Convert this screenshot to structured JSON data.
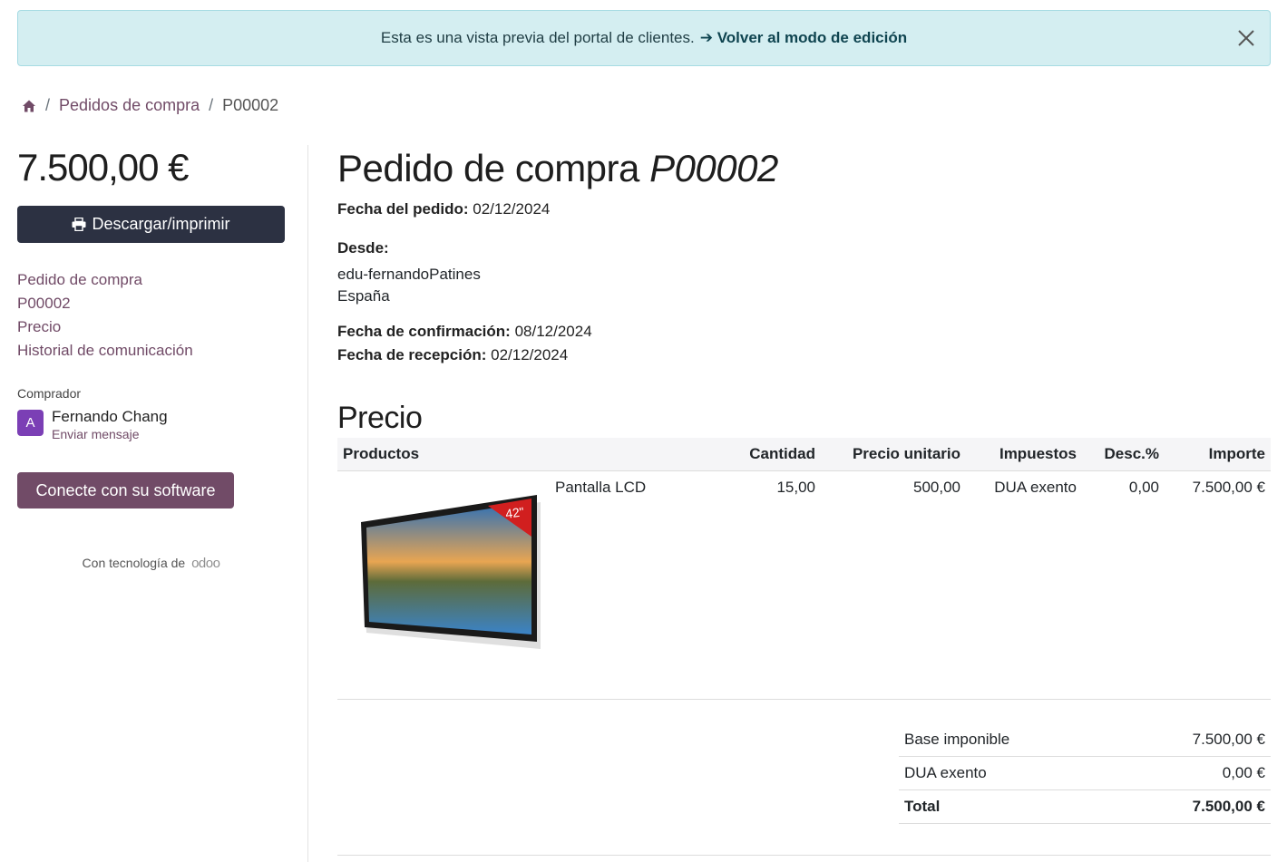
{
  "banner": {
    "text": "Esta es una vista previa del portal de clientes.",
    "link": "➔ Volver al modo de edición"
  },
  "breadcrumb": {
    "items": [
      "Pedidos de compra",
      "P00002"
    ]
  },
  "sidebar": {
    "amount": "7.500,00 €",
    "download_label": "Descargar/imprimir",
    "toc": [
      "Pedido de compra",
      "P00002",
      "Precio",
      "Historial de comunicación"
    ],
    "buyer_label": "Comprador",
    "buyer_initial": "A",
    "buyer_name": "Fernando Chang",
    "buyer_action": "Enviar mensaje",
    "connect_label": "Conecte con su software",
    "powered_by": "Con tecnología de",
    "powered_brand": "odoo"
  },
  "order": {
    "title": "Pedido de compra",
    "ref": "P00002",
    "date_label": "Fecha del pedido:",
    "date": "02/12/2024",
    "from_label": "Desde:",
    "from_line1": "edu-fernandoPatines",
    "from_line2": "España",
    "confirm_label": "Fecha de confirmación:",
    "confirm_date": "08/12/2024",
    "receipt_label": "Fecha de recepción:",
    "receipt_date": "02/12/2024"
  },
  "pricing": {
    "title": "Precio",
    "columns": [
      "Productos",
      "Cantidad",
      "Precio unitario",
      "Impuestos",
      "Desc.%",
      "Importe"
    ],
    "lines": [
      {
        "product": "Pantalla LCD",
        "image_badge": "42\"",
        "quantity": "15,00",
        "unit_price": "500,00",
        "taxes": "DUA exento",
        "discount": "0,00",
        "amount": "7.500,00 €"
      }
    ]
  },
  "totals": {
    "untaxed_label": "Base imponible",
    "untaxed": "7.500,00 €",
    "tax_label": "DUA exento",
    "tax": "0,00 €",
    "total_label": "Total",
    "total": "7.500,00 €"
  },
  "colors": {
    "accent": "#714b67",
    "dark_button": "#2c3142",
    "banner_bg": "#d4eef1",
    "avatar": "#7b3fb5"
  }
}
